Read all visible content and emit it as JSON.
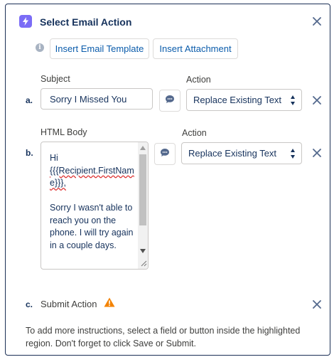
{
  "header": {
    "title": "Select Email Action"
  },
  "toolbar": {
    "insert_template": "Insert Email Template",
    "insert_attachment": "Insert Attachment"
  },
  "rows": {
    "a": {
      "letter": "a.",
      "field_label": "Subject",
      "field_value": "Sorry I Missed You",
      "action_label": "Action",
      "action_value": "Replace Existing Text"
    },
    "b": {
      "letter": "b.",
      "field_label": "HTML Body",
      "body_line1": "Hi",
      "body_token": "{{{Recipient.FirstName}}},",
      "body_paragraph": "Sorry I wasn't able to reach you on the phone. I will try again in a couple days.",
      "action_label": "Action",
      "action_value": "Replace Existing Text"
    },
    "c": {
      "letter": "c.",
      "label": "Submit Action"
    }
  },
  "footer_text": "To add more instructions, select a field or button inside the highlighted region. Don't forget to click Save or Submit.",
  "icons": {
    "title": "lightning-bolt-icon",
    "info": "info-icon",
    "close": "close-icon",
    "chat": "chat-bubble-icon",
    "warning": "warning-icon"
  },
  "colors": {
    "accent": "#7b6cf6",
    "link": "#0b5cab",
    "warning": "#f38303",
    "text": "#16325c"
  }
}
